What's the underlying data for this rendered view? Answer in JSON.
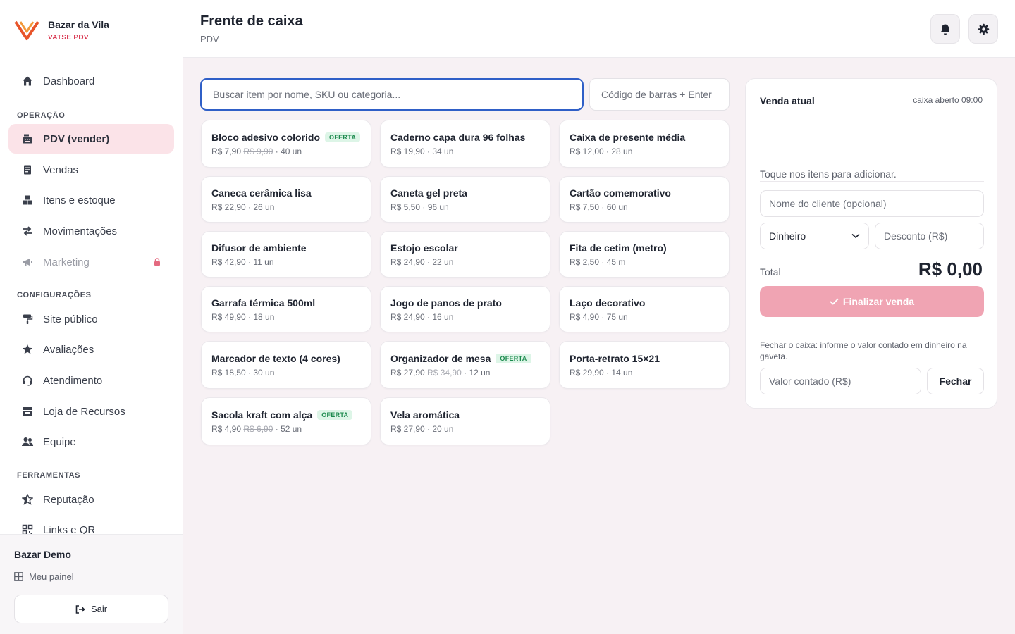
{
  "brand": {
    "name": "Bazar da Vila",
    "subtitle": "VATSE PDV"
  },
  "nav": {
    "dashboard": "Dashboard",
    "section_operacao": "OPERAÇÃO",
    "pdv": "PDV (vender)",
    "vendas": "Vendas",
    "itens": "Itens e estoque",
    "movimentacoes": "Movimentações",
    "marketing": "Marketing",
    "section_config": "CONFIGURAÇÕES",
    "site": "Site público",
    "avaliacoes": "Avaliações",
    "atendimento": "Atendimento",
    "loja": "Loja de Recursos",
    "equipe": "Equipe",
    "section_ferramentas": "FERRAMENTAS",
    "reputacao": "Reputação",
    "links": "Links e QR"
  },
  "footer": {
    "user": "Bazar Demo",
    "panel": "Meu painel",
    "logout": "Sair"
  },
  "header": {
    "title": "Frente de caixa",
    "subtitle": "PDV"
  },
  "search": {
    "placeholder": "Buscar item por nome, SKU ou categoria...",
    "barcode_placeholder": "Código de barras + Enter"
  },
  "offer_label": "OFERTA",
  "products": [
    {
      "name": "Bloco adesivo colorido",
      "offer": true,
      "price": "R$ 7,90",
      "old_price": "R$ 9,90",
      "stock": "40 un"
    },
    {
      "name": "Caderno capa dura 96 folhas",
      "offer": false,
      "price": "R$ 19,90",
      "old_price": "",
      "stock": "34 un"
    },
    {
      "name": "Caixa de presente média",
      "offer": false,
      "price": "R$ 12,00",
      "old_price": "",
      "stock": "28 un"
    },
    {
      "name": "Caneca cerâmica lisa",
      "offer": false,
      "price": "R$ 22,90",
      "old_price": "",
      "stock": "26 un"
    },
    {
      "name": "Caneta gel preta",
      "offer": false,
      "price": "R$ 5,50",
      "old_price": "",
      "stock": "96 un"
    },
    {
      "name": "Cartão comemorativo",
      "offer": false,
      "price": "R$ 7,50",
      "old_price": "",
      "stock": "60 un"
    },
    {
      "name": "Difusor de ambiente",
      "offer": false,
      "price": "R$ 42,90",
      "old_price": "",
      "stock": "11 un"
    },
    {
      "name": "Estojo escolar",
      "offer": false,
      "price": "R$ 24,90",
      "old_price": "",
      "stock": "22 un"
    },
    {
      "name": "Fita de cetim (metro)",
      "offer": false,
      "price": "R$ 2,50",
      "old_price": "",
      "stock": "45 m"
    },
    {
      "name": "Garrafa térmica 500ml",
      "offer": false,
      "price": "R$ 49,90",
      "old_price": "",
      "stock": "18 un"
    },
    {
      "name": "Jogo de panos de prato",
      "offer": false,
      "price": "R$ 24,90",
      "old_price": "",
      "stock": "16 un"
    },
    {
      "name": "Laço decorativo",
      "offer": false,
      "price": "R$ 4,90",
      "old_price": "",
      "stock": "75 un"
    },
    {
      "name": "Marcador de texto (4 cores)",
      "offer": false,
      "price": "R$ 18,50",
      "old_price": "",
      "stock": "30 un"
    },
    {
      "name": "Organizador de mesa",
      "offer": true,
      "price": "R$ 27,90",
      "old_price": "R$ 34,90",
      "stock": "12 un"
    },
    {
      "name": "Porta-retrato 15×21",
      "offer": false,
      "price": "R$ 29,90",
      "old_price": "",
      "stock": "14 un"
    },
    {
      "name": "Sacola kraft com alça",
      "offer": true,
      "price": "R$ 4,90",
      "old_price": "R$ 6,90",
      "stock": "52 un"
    },
    {
      "name": "Vela aromática",
      "offer": false,
      "price": "R$ 27,90",
      "old_price": "",
      "stock": "20 un"
    }
  ],
  "sale": {
    "title": "Venda atual",
    "time": "caixa aberto 09:00",
    "empty": "Toque nos itens para adicionar.",
    "customer_placeholder": "Nome do cliente (opcional)",
    "payment": "Dinheiro",
    "discount_placeholder": "Desconto (R$)",
    "total_label": "Total",
    "total_value": "R$ 0,00",
    "finish": "Finalizar venda",
    "close_note": "Fechar o caixa: informe o valor contado em dinheiro na gaveta.",
    "counted_placeholder": "Valor contado (R$)",
    "close_button": "Fechar"
  },
  "colors": {
    "accent": "#d93650",
    "active_bg": "#fbe3e8",
    "focus": "#2f5fc7",
    "finish_btn": "#f0a4b3",
    "offer_green": "#1d8a4e"
  }
}
